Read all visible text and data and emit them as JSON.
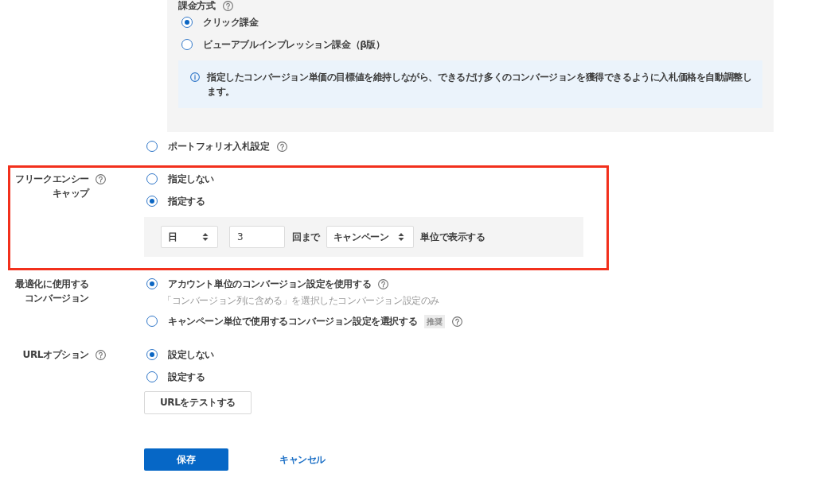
{
  "bid_strategy_panel": {
    "billing_method": {
      "label": "課金方式",
      "help": true,
      "options": [
        {
          "label": "クリック課金",
          "selected": true,
          "help": false
        },
        {
          "label": "ビューアブルインプレッション課金（β版）",
          "selected": false,
          "help": false
        }
      ]
    },
    "info": "指定したコンバージョン単価の目標値を維持しながら、できるだけ多くのコンバージョンを獲得できるように入札価格を自動調整します。"
  },
  "portfolio_option": {
    "label": "ポートフォリオ入札設定",
    "selected": false,
    "help": true
  },
  "sections": [
    {
      "kind": "frequency",
      "label": "フリークエンシーキャップ",
      "help": true,
      "highlighted": true,
      "options": [
        {
          "label": "指定しない",
          "selected": false,
          "help": false
        },
        {
          "label": "指定する",
          "selected": true,
          "help": false
        }
      ],
      "cap": {
        "period": "日",
        "count": "3",
        "count_suffix": "回まで",
        "scope": "キャンペーン",
        "scope_suffix": "単位で表示する"
      }
    },
    {
      "kind": "conversion",
      "label": "最適化に使用するコンバージョン",
      "help": false,
      "highlighted": false,
      "options": [
        {
          "label": "アカウント単位のコンバージョン設定を使用する",
          "selected": true,
          "help": true,
          "note": "「コンバージョン列に含める」を選択したコンバージョン設定のみ"
        },
        {
          "label": "キャンペーン単位で使用するコンバージョン設定を選択する",
          "selected": false,
          "help": true,
          "tag": "推奨"
        }
      ]
    },
    {
      "kind": "url",
      "label": "URLオプション",
      "help": true,
      "highlighted": false,
      "options": [
        {
          "label": "設定しない",
          "selected": true,
          "help": false
        },
        {
          "label": "設定する",
          "selected": false,
          "help": false
        }
      ],
      "test_button": "URLをテストする"
    }
  ],
  "footer": {
    "save_button": "保存",
    "cancel_link": "キャンセル"
  }
}
